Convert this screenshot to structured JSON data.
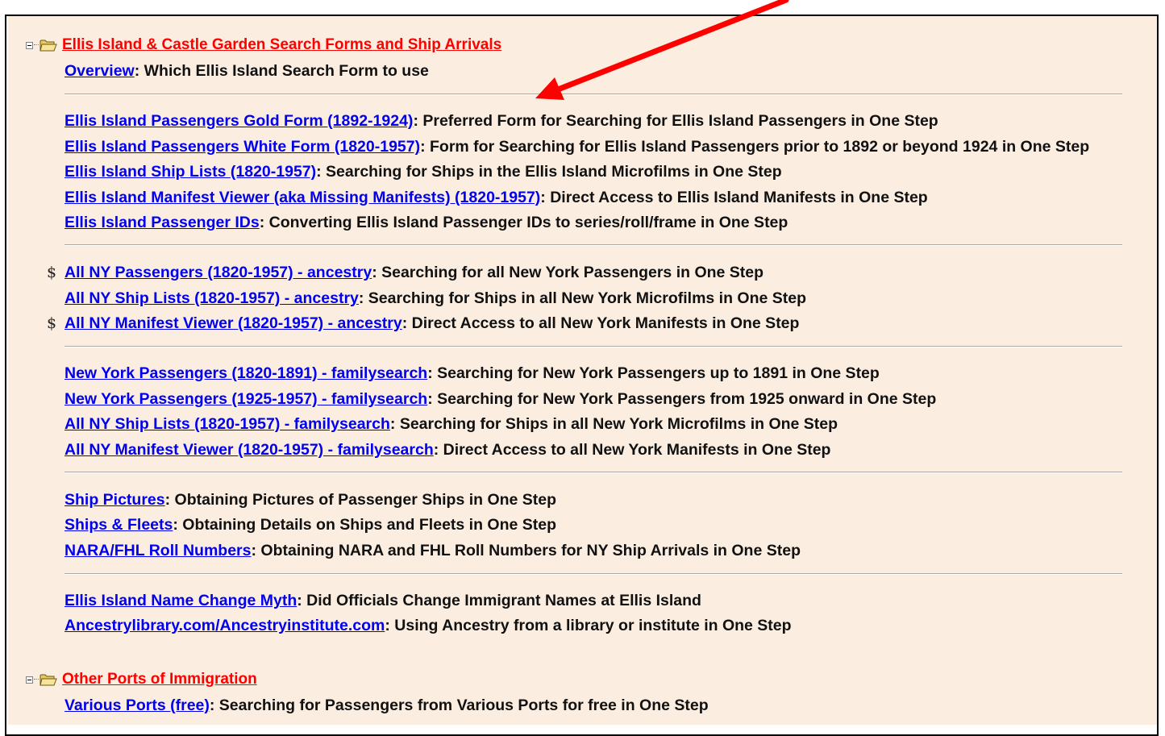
{
  "sections": [
    {
      "title": "Ellis Island & Castle Garden Search Forms and Ship Arrivals",
      "expander_icon": "minus-box-icon",
      "folder_icon": "open-folder-icon"
    },
    {
      "title": "Other Ports of Immigration",
      "expander_icon": "minus-box-icon",
      "folder_icon": "open-folder-icon"
    }
  ],
  "rows": [
    {
      "link": "Overview",
      "desc": ": Which Ellis Island Search Form to use"
    },
    {
      "link": "Ellis Island Passengers Gold Form (1892-1924)",
      "desc": ": Preferred Form for Searching for Ellis Island Passengers in One Step"
    },
    {
      "link": "Ellis Island Passengers White Form (1820-1957)",
      "desc": ": Form for Searching for Ellis Island Passengers prior to 1892 or beyond 1924 in One Step"
    },
    {
      "link": "Ellis Island Ship Lists (1820-1957)",
      "desc": ": Searching for Ships in the Ellis Island Microfilms in One Step"
    },
    {
      "link": "Ellis Island Manifest Viewer (aka Missing Manifests) (1820-1957)",
      "desc": ": Direct Access to Ellis Island Manifests in One Step"
    },
    {
      "link": "Ellis Island Passenger IDs",
      "desc": ": Converting Ellis Island Passenger IDs to series/roll/frame in One Step"
    },
    {
      "link": "All NY Passengers (1820-1957) - ancestry",
      "desc": ": Searching for all New York Passengers in One Step",
      "marker": "$"
    },
    {
      "link": "All NY Ship Lists (1820-1957) - ancestry",
      "desc": ": Searching for Ships in all New York Microfilms in One Step"
    },
    {
      "link": "All NY Manifest Viewer (1820-1957) - ancestry",
      "desc": ": Direct Access to all New York Manifests in One Step",
      "marker": "$"
    },
    {
      "link": "New York Passengers (1820-1891) - familysearch",
      "desc": ": Searching for New York Passengers up to 1891 in One Step"
    },
    {
      "link": "New York Passengers (1925-1957) - familysearch",
      "desc": ": Searching for New York Passengers from 1925 onward in One Step"
    },
    {
      "link": "All NY Ship Lists (1820-1957) - familysearch",
      "desc": ": Searching for Ships in all New York Microfilms in One Step"
    },
    {
      "link": "All NY Manifest Viewer (1820-1957) - familysearch",
      "desc": ": Direct Access to all New York Manifests in One Step"
    },
    {
      "link": "Ship Pictures",
      "desc": ": Obtaining Pictures of Passenger Ships in One Step"
    },
    {
      "link": "Ships & Fleets",
      "desc": ": Obtaining Details on Ships and Fleets in One Step"
    },
    {
      "link": "NARA/FHL Roll Numbers",
      "desc": ": Obtaining NARA and FHL Roll Numbers for NY Ship Arrivals in One Step"
    },
    {
      "link": "Ellis Island Name Change Myth",
      "desc": ": Did Officials Change Immigrant Names at Ellis Island"
    },
    {
      "link": "Ancestrylibrary.com/Ancestryinstitute.com",
      "desc": ": Using Ancestry from a library or institute in One Step"
    },
    {
      "link": "Various Ports (free)",
      "desc": ": Searching for Passengers from Various Ports for free in One Step"
    }
  ],
  "annotation": {
    "icon": "red-arrow-icon",
    "color": "#ff0000"
  },
  "colors": {
    "panel_bg": "#fbeee1",
    "link": "#0000ee",
    "section_title": "#ff0000"
  }
}
